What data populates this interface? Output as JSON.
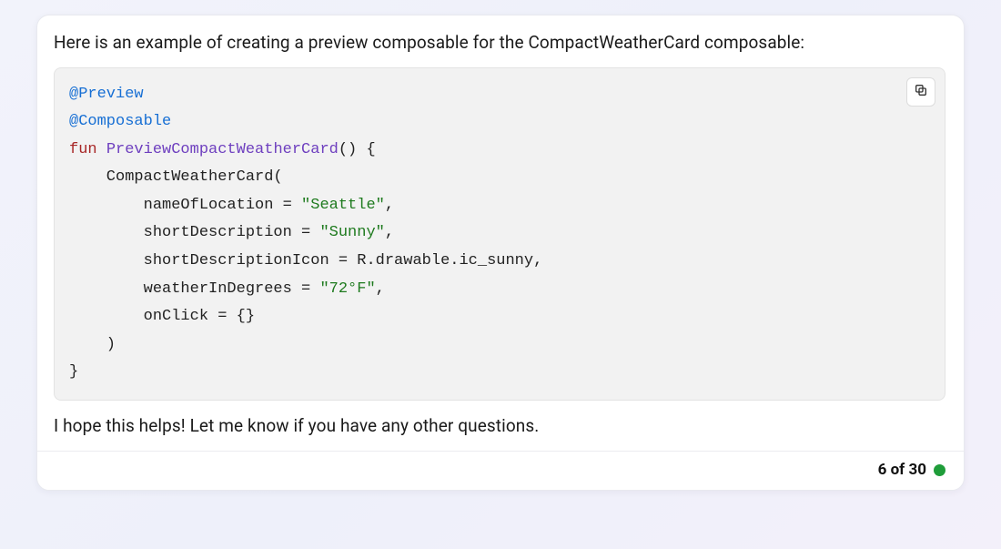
{
  "intro": "Here is an example of creating a preview composable for the CompactWeatherCard composable:",
  "outro": "I hope this helps! Let me know if you have any other questions.",
  "pager": {
    "current": 6,
    "total": 30,
    "sep": " of "
  },
  "status_color": "#1f9d3a",
  "code": {
    "ann_preview": "@Preview",
    "ann_composable": "@Composable",
    "kw_fun": "fun",
    "fn_name": "PreviewCompactWeatherCard",
    "open_sig": "() {",
    "call_open": "    CompactWeatherCard(",
    "arg1_key": "        nameOfLocation = ",
    "arg1_val": "\"Seattle\"",
    "arg1_end": ",",
    "arg2_key": "        shortDescription = ",
    "arg2_val": "\"Sunny\"",
    "arg2_end": ",",
    "arg3": "        shortDescriptionIcon = R.drawable.ic_sunny,",
    "arg4_key": "        weatherInDegrees = ",
    "arg4_val": "\"72°F\"",
    "arg4_end": ",",
    "arg5": "        onClick = {}",
    "call_close": "    )",
    "close": "}"
  }
}
